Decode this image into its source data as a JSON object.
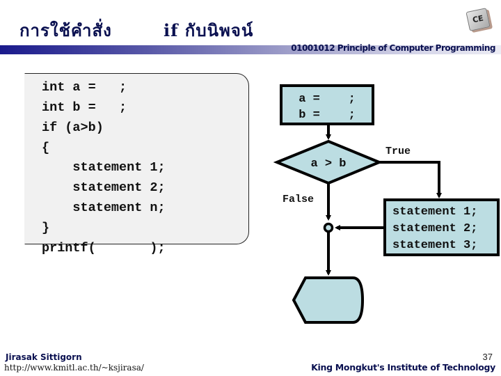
{
  "header": {
    "title_thai": "การใช้คำสั่ง",
    "title_rest": "if กับนิพจน์",
    "course": "01001012 Principle of Computer Programming",
    "logo_text": "CE"
  },
  "code_panel": {
    "lines": [
      "int a =   ;",
      "int b =   ;",
      "if (a>b)",
      "{",
      "    statement 1;",
      "    statement 2;",
      "    statement n;",
      "}",
      "printf(       );"
    ]
  },
  "flowchart": {
    "process_lines": [
      "a =    ;",
      "b =    ;"
    ],
    "decision": "a > b",
    "true_label": "True",
    "false_label": "False",
    "statements": [
      "statement 1;",
      "statement 2;",
      "statement 3;"
    ],
    "fill_color": "#bcdde2",
    "stroke_color": "#000000"
  },
  "footer": {
    "author": "Jirasak Sittigorn",
    "url": "http://www.kmitl.ac.th/~ksjirasa/",
    "page": "37",
    "institute": "King Mongkut's Institute of Technology"
  }
}
